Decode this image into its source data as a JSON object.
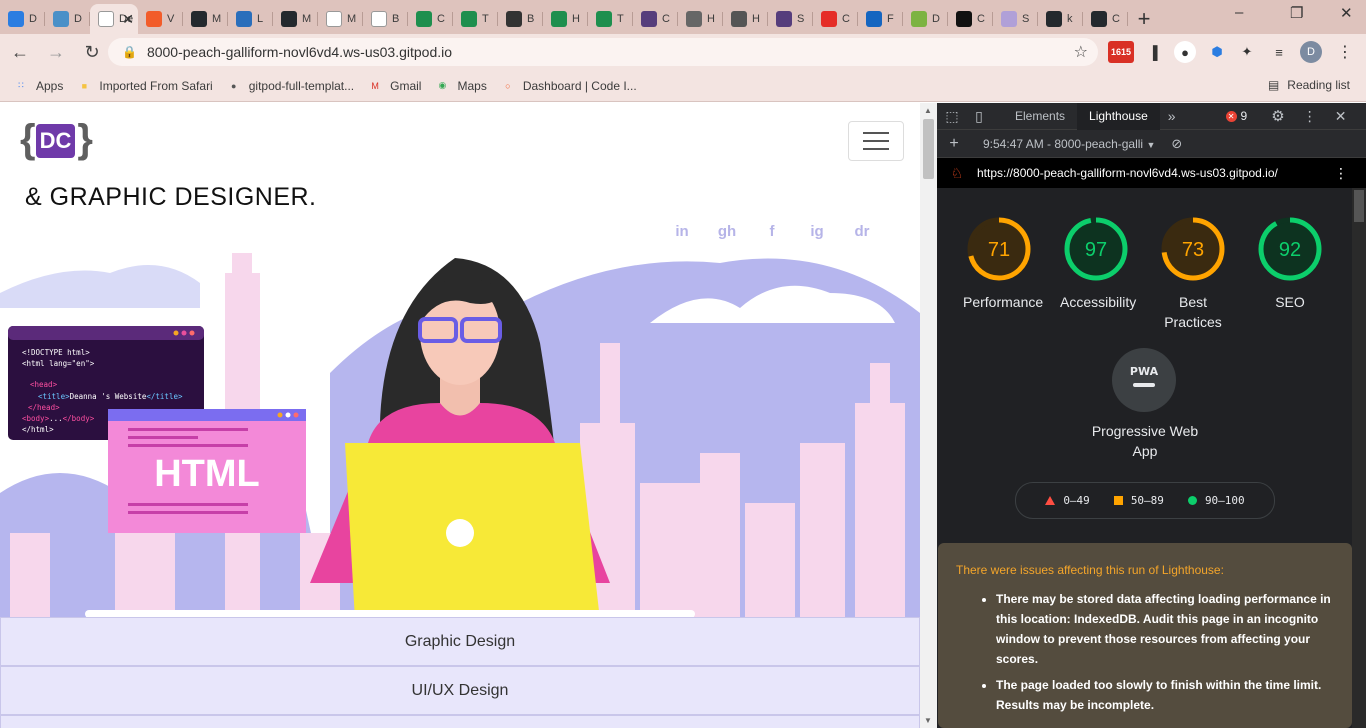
{
  "tabs": [
    {
      "letter": "D",
      "color": "#2b7de1"
    },
    {
      "letter": "D",
      "color": "#4a90c8"
    },
    {
      "letter": "D",
      "active": true,
      "title": "De",
      "color": "#ffffff"
    },
    {
      "letter": "V",
      "color": "#f25c2a"
    },
    {
      "letter": "M",
      "color": "#24292e"
    },
    {
      "letter": "L",
      "color": "#2a6ebb"
    },
    {
      "letter": "M",
      "color": "#24292e"
    },
    {
      "letter": "M",
      "color": "#ffffff"
    },
    {
      "letter": "B",
      "color": "#ffffff"
    },
    {
      "letter": "C",
      "color": "#1e8f4e"
    },
    {
      "letter": "T",
      "color": "#1e8f4e"
    },
    {
      "letter": "B",
      "color": "#333333"
    },
    {
      "letter": "H",
      "color": "#1e8f4e"
    },
    {
      "letter": "T",
      "color": "#1e8f4e"
    },
    {
      "letter": "C",
      "color": "#563d7c"
    },
    {
      "letter": "H",
      "color": "#666666"
    },
    {
      "letter": "H",
      "color": "#555555"
    },
    {
      "letter": "S",
      "color": "#563d7c"
    },
    {
      "letter": "C",
      "color": "#e52d27"
    },
    {
      "letter": "F",
      "color": "#1565c0"
    },
    {
      "letter": "D",
      "color": "#7cb342"
    },
    {
      "letter": "C",
      "color": "#111111"
    },
    {
      "letter": "S",
      "color": "#b0a0d8"
    },
    {
      "letter": "k",
      "color": "#24292e"
    },
    {
      "letter": "C",
      "color": "#24292e"
    }
  ],
  "address": {
    "url": "8000-peach-galliform-novl6vd4.ws-us03.gitpod.io"
  },
  "extensions": {
    "gmail_badge": "1615"
  },
  "profile_initial": "D",
  "bookmarks": [
    {
      "label": "Apps",
      "icon": "apps-grid-icon"
    },
    {
      "label": "Imported From Safari",
      "icon": "folder-icon"
    },
    {
      "label": "gitpod-full-templat...",
      "icon": "github-icon"
    },
    {
      "label": "Gmail",
      "icon": "gmail-icon"
    },
    {
      "label": "Maps",
      "icon": "maps-icon"
    },
    {
      "label": "Dashboard | Code I...",
      "icon": "codeinstitute-icon"
    }
  ],
  "reading_list": "Reading list",
  "page": {
    "logo_left": "{",
    "logo_mid": "DC",
    "logo_right": "}",
    "hero_title": "& GRAPHIC DESIGNER.",
    "socials": [
      "in",
      "gh",
      "f",
      "ig",
      "dr"
    ],
    "code_window": {
      "line1": "<!DOCTYPE html>",
      "line2": "<html lang=\"en\">",
      "line3": "<head>",
      "line4a": "<title>",
      "line4b": "Deanna 's Website",
      "line4c": "</title>",
      "line5": "</head>",
      "line6a": "<body>",
      "line6b": "...",
      "line6c": "</body>",
      "line7": "</html>"
    },
    "html_label": "HTML",
    "accordion": [
      "Graphic Design",
      "UI/UX Design"
    ]
  },
  "devtools": {
    "tabs": [
      "Elements",
      "Lighthouse"
    ],
    "error_count": "9",
    "report_time": "9:54:47 AM - 8000-peach-galli",
    "report_url": "https://8000-peach-galliform-novl6vd4.ws-us03.gitpod.io/",
    "scores": [
      {
        "value": "71",
        "label": "Performance",
        "color": "#ffa400",
        "bg": "#3a2a10"
      },
      {
        "value": "97",
        "label": "Accessibility",
        "color": "#0cce6b",
        "bg": "#0d3320"
      },
      {
        "value": "73",
        "label": "Best Practices",
        "color": "#ffa400",
        "bg": "#3a2a10"
      },
      {
        "value": "92",
        "label": "SEO",
        "color": "#0cce6b",
        "bg": "#0d3320"
      }
    ],
    "pwa_badge": "PWA",
    "pwa_label": "Progressive Web App",
    "legend": [
      "0–49",
      "50–89",
      "90–100"
    ],
    "legend_colors": [
      "#ff4e42",
      "#ffa400",
      "#0cce6b"
    ],
    "issues_heading": "There were issues affecting this run of Lighthouse:",
    "issues": [
      "There may be stored data affecting loading performance in this location: IndexedDB. Audit this page in an incognito window to prevent those resources from affecting your scores.",
      "The page loaded too slowly to finish within the time limit. Results may be incomplete."
    ]
  }
}
